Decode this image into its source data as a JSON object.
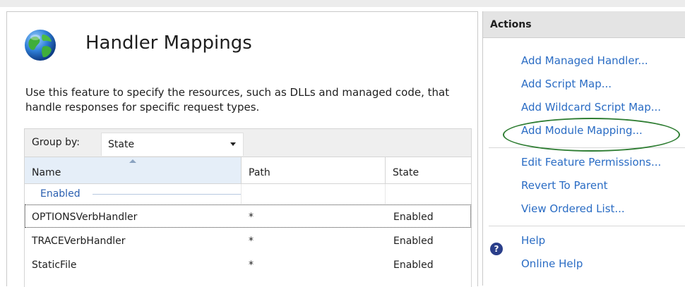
{
  "main": {
    "title": "Handler Mappings",
    "description": "Use this feature to specify the resources, such as DLLs and managed code, that handle responses for specific request types."
  },
  "grid": {
    "group_by_label": "Group by:",
    "group_by_value": "State",
    "columns": [
      "Name",
      "Path",
      "State"
    ],
    "group_label": "Enabled",
    "rows": [
      {
        "name": "OPTIONSVerbHandler",
        "path": "*",
        "state": "Enabled"
      },
      {
        "name": "TRACEVerbHandler",
        "path": "*",
        "state": "Enabled"
      },
      {
        "name": "StaticFile",
        "path": "*",
        "state": "Enabled"
      }
    ]
  },
  "actions": {
    "header": "Actions",
    "group1": [
      "Add Managed Handler...",
      "Add Script Map...",
      "Add Wildcard Script Map...",
      "Add Module Mapping..."
    ],
    "group2": [
      "Edit Feature Permissions...",
      "Revert To Parent",
      "View Ordered List..."
    ],
    "group3": [
      "Help",
      "Online Help"
    ]
  },
  "icons": {
    "feature_icon": "globe-icon",
    "help_icon": "help-icon"
  },
  "colors": {
    "link": "#2a6cc4",
    "highlight_ring": "#2e7d32"
  }
}
